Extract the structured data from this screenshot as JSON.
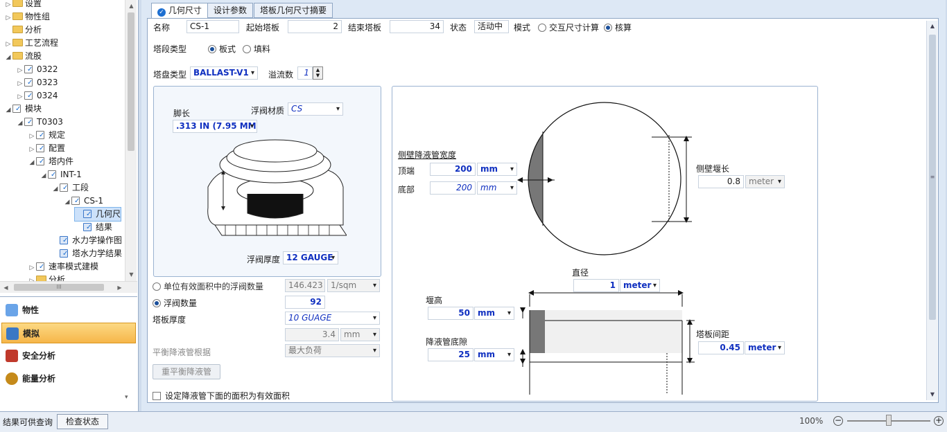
{
  "tree": {
    "items": [
      {
        "label": "设置",
        "indent": 0,
        "arrow": "▷",
        "icon": "folder"
      },
      {
        "label": "物性组",
        "indent": 0,
        "arrow": "▷",
        "icon": "folder"
      },
      {
        "label": "分析",
        "indent": 0,
        "arrow": "",
        "icon": "folder"
      },
      {
        "label": "工艺流程",
        "indent": 0,
        "arrow": "▷",
        "icon": "folder"
      },
      {
        "label": "流股",
        "indent": 0,
        "arrow": "◢",
        "icon": "folder"
      },
      {
        "label": "0322",
        "indent": 1,
        "arrow": "▷",
        "icon": "folder-check"
      },
      {
        "label": "0323",
        "indent": 1,
        "arrow": "▷",
        "icon": "folder-check"
      },
      {
        "label": "0324",
        "indent": 1,
        "arrow": "▷",
        "icon": "folder-check"
      },
      {
        "label": "模块",
        "indent": 0,
        "arrow": "◢",
        "icon": "folder-check"
      },
      {
        "label": "T0303",
        "indent": 1,
        "arrow": "◢",
        "icon": "folder-check"
      },
      {
        "label": "规定",
        "indent": 2,
        "arrow": "▷",
        "icon": "folder-check"
      },
      {
        "label": "配置",
        "indent": 2,
        "arrow": "▷",
        "icon": "folder-check"
      },
      {
        "label": "塔内件",
        "indent": 2,
        "arrow": "◢",
        "icon": "folder-check"
      },
      {
        "label": "INT-1",
        "indent": 3,
        "arrow": "◢",
        "icon": "folder-check"
      },
      {
        "label": "工段",
        "indent": 4,
        "arrow": "◢",
        "icon": "folder-check"
      },
      {
        "label": "CS-1",
        "indent": 5,
        "arrow": "◢",
        "icon": "folder-check"
      },
      {
        "label": "几何尺",
        "indent": 6,
        "arrow": "",
        "icon": "form-check"
      },
      {
        "label": "结果",
        "indent": 6,
        "arrow": "",
        "icon": "form-check"
      },
      {
        "label": "水力学操作图",
        "indent": 4,
        "arrow": "",
        "icon": "form-check"
      },
      {
        "label": "塔水力学结果",
        "indent": 4,
        "arrow": "",
        "icon": "form-check"
      },
      {
        "label": "速率模式建模",
        "indent": 2,
        "arrow": "▷",
        "icon": "folder-check"
      },
      {
        "label": "分析",
        "indent": 2,
        "arrow": "▷",
        "icon": "folder"
      }
    ],
    "hscroll_label": "III"
  },
  "nav": {
    "items": [
      {
        "label": "物性",
        "icon": "flask-icon",
        "active": false
      },
      {
        "label": "模拟",
        "icon": "flowsheet-icon",
        "active": true
      },
      {
        "label": "安全分析",
        "icon": "safety-icon",
        "active": false
      },
      {
        "label": "能量分析",
        "icon": "energy-icon",
        "active": false
      }
    ]
  },
  "tabs": [
    "几何尺寸",
    "设计参数",
    "塔板几何尺寸摘要"
  ],
  "form": {
    "name_label": "名称",
    "name_value": "CS-1",
    "start_tray_label": "起始塔板",
    "start_tray_value": "2",
    "end_tray_label": "结束塔板",
    "end_tray_value": "34",
    "status_label": "状态",
    "status_value": "活动中",
    "mode_label": "模式",
    "mode_interactive": "交互尺寸计算",
    "mode_rating": "核算",
    "section_type_label": "塔段类型",
    "section_type_tray": "板式",
    "section_type_packed": "填料",
    "tray_type_label": "塔盘类型",
    "tray_type_value": "BALLAST-V1",
    "passes_label": "溢流数",
    "passes_value": "1"
  },
  "valve": {
    "leg_label": "脚长",
    "leg_value": ".313 IN (7.95 MM)",
    "material_label": "浮阀材质",
    "material_value": "CS",
    "thickness_label": "浮阀厚度",
    "thickness_value": "12 GAUGE"
  },
  "density": {
    "per_area_label": "单位有效面积中的浮阀数量",
    "per_area_value": "146.423",
    "per_area_unit": "1/sqm",
    "count_label": "浮阀数量",
    "count_value": "92",
    "tray_thickness_label": "塔板厚度",
    "tray_thickness_value": "10 GUAGE",
    "tray_thickness_num": "3.4",
    "tray_thickness_unit": "mm",
    "balance_label": "平衡降液管根据",
    "balance_value": "最大负荷",
    "rebalance_button": "重平衡降液管",
    "checkbox_label": "设定降液管下面的面积为有效面积"
  },
  "geometry": {
    "side_dc_width_label": "侧壁降液管宽度",
    "top_label": "顶端",
    "top_value": "200",
    "top_unit": "mm",
    "bottom_label": "底部",
    "bottom_value": "200",
    "bottom_unit": "mm",
    "weir_length_label": "侧壁堰长",
    "weir_length_value": "0.8",
    "weir_length_unit": "meter",
    "diameter_label": "直径",
    "diameter_value": "1",
    "diameter_unit": "meter",
    "weir_height_label": "堰高",
    "weir_height_value": "50",
    "weir_height_unit": "mm",
    "clearance_label": "降液管底隙",
    "clearance_value": "25",
    "clearance_unit": "mm",
    "spacing_label": "塔板间距",
    "spacing_value": "0.45",
    "spacing_unit": "meter"
  },
  "status": {
    "left_text": "结果可供查询",
    "check_button": "检查状态",
    "zoom": "100%"
  }
}
